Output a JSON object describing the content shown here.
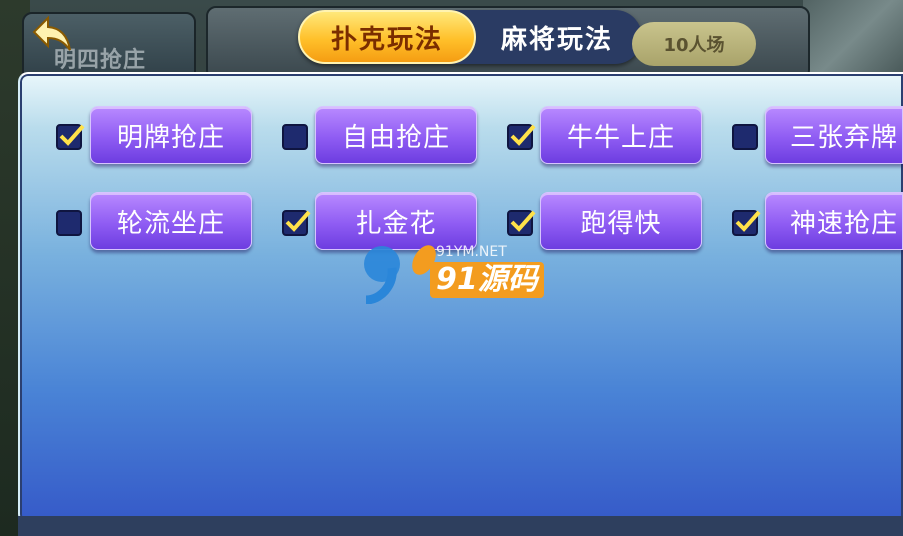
{
  "header": {
    "back_tab_label": "明四抢庄",
    "tabs": [
      {
        "label": "扑克玩法",
        "active": true
      },
      {
        "label": "麻将玩法",
        "active": false
      }
    ],
    "room_badge": "10人场"
  },
  "options": [
    {
      "label": "明牌抢庄",
      "checked": true
    },
    {
      "label": "自由抢庄",
      "checked": false
    },
    {
      "label": "牛牛上庄",
      "checked": true
    },
    {
      "label": "三张弃牌",
      "checked": false
    },
    {
      "label": "轮流坐庄",
      "checked": false
    },
    {
      "label": "扎金花",
      "checked": true
    },
    {
      "label": "跑得快",
      "checked": true
    },
    {
      "label": "神速抢庄",
      "checked": true
    }
  ],
  "watermark": {
    "domain": "91YM.NET",
    "brand": "91源码"
  },
  "colors": {
    "tab_active": "#ffc02a",
    "option_button": "#8f5cf3",
    "checkbox": "#1e2a6e"
  }
}
